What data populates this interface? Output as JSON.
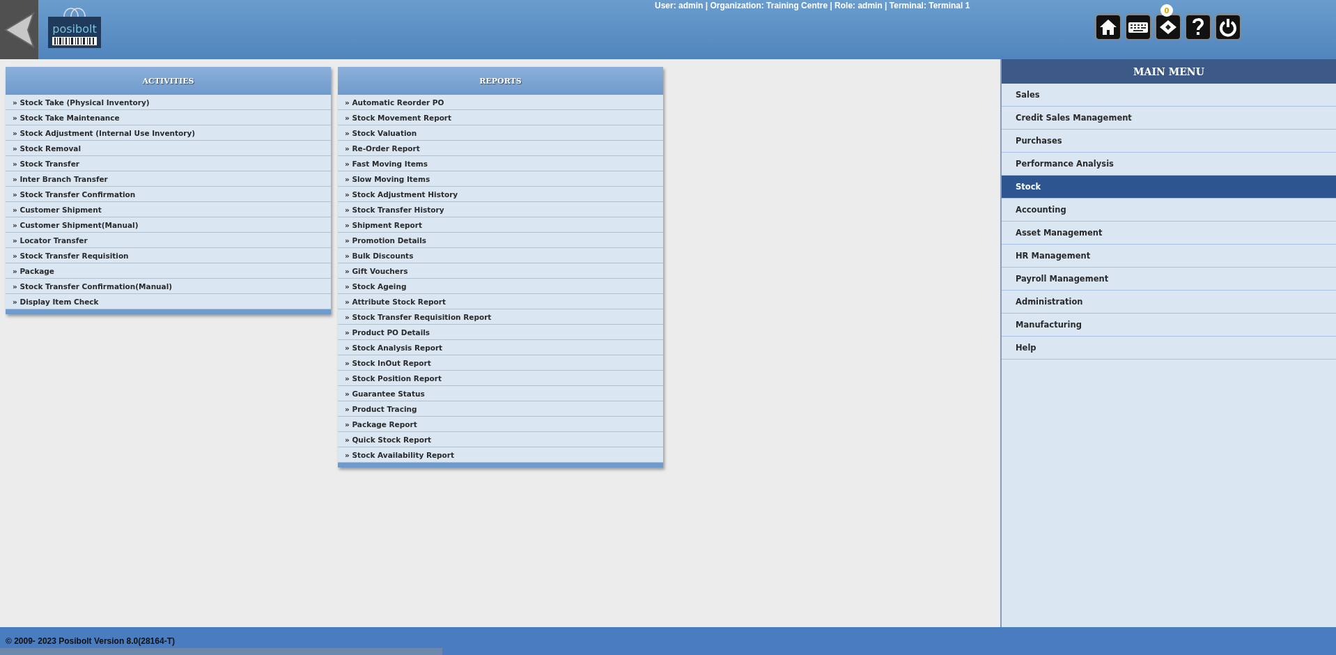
{
  "header": {
    "user_info": "User: admin | Organization: Training Centre | Role: admin | Terminal: Terminal 1",
    "logo_text": "posibolt",
    "notification_count": "0"
  },
  "panels": [
    {
      "title": "ACTIVITIES",
      "items": [
        "» Stock Take (Physical Inventory)",
        "» Stock Take Maintenance",
        "» Stock Adjustment (Internal Use Inventory)",
        "» Stock Removal",
        "» Stock Transfer",
        "» Inter Branch Transfer",
        "» Stock Transfer Confirmation",
        "» Customer Shipment",
        "» Customer Shipment(Manual)",
        "» Locator Transfer",
        "» Stock Transfer Requisition",
        "» Package",
        "» Stock Transfer Confirmation(Manual)",
        "» Display Item Check"
      ]
    },
    {
      "title": "REPORTS",
      "items": [
        "» Automatic Reorder PO",
        "» Stock Movement Report",
        "» Stock Valuation",
        "» Re-Order Report",
        "» Fast Moving Items",
        "» Slow Moving Items",
        "» Stock Adjustment History",
        "» Stock Transfer History",
        "» Shipment Report",
        "» Promotion Details",
        "» Bulk Discounts",
        "» Gift Vouchers",
        "» Stock Ageing",
        "» Attribute Stock Report",
        "» Stock Transfer Requisition Report",
        "» Product PO Details",
        "» Stock Analysis Report",
        "» Stock InOut Report",
        "» Stock Position Report",
        "» Guarantee Status",
        "» Product Tracing",
        "» Package Report",
        "» Quick Stock Report",
        "» Stock Availability Report"
      ]
    }
  ],
  "main_menu": {
    "title": "MAIN MENU",
    "items": [
      {
        "label": "Sales",
        "selected": false
      },
      {
        "label": "Credit Sales Management",
        "selected": false
      },
      {
        "label": "Purchases",
        "selected": false
      },
      {
        "label": "Performance Analysis",
        "selected": false
      },
      {
        "label": "Stock",
        "selected": true
      },
      {
        "label": "Accounting",
        "selected": false
      },
      {
        "label": "Asset Management",
        "selected": false
      },
      {
        "label": "HR Management",
        "selected": false
      },
      {
        "label": "Payroll Management",
        "selected": false
      },
      {
        "label": "Administration",
        "selected": false
      },
      {
        "label": "Manufacturing",
        "selected": false
      },
      {
        "label": "Help",
        "selected": false
      }
    ]
  },
  "footer": {
    "copyright": "© 2009- 2023 Posibolt Version  8.0(28164-T)"
  }
}
